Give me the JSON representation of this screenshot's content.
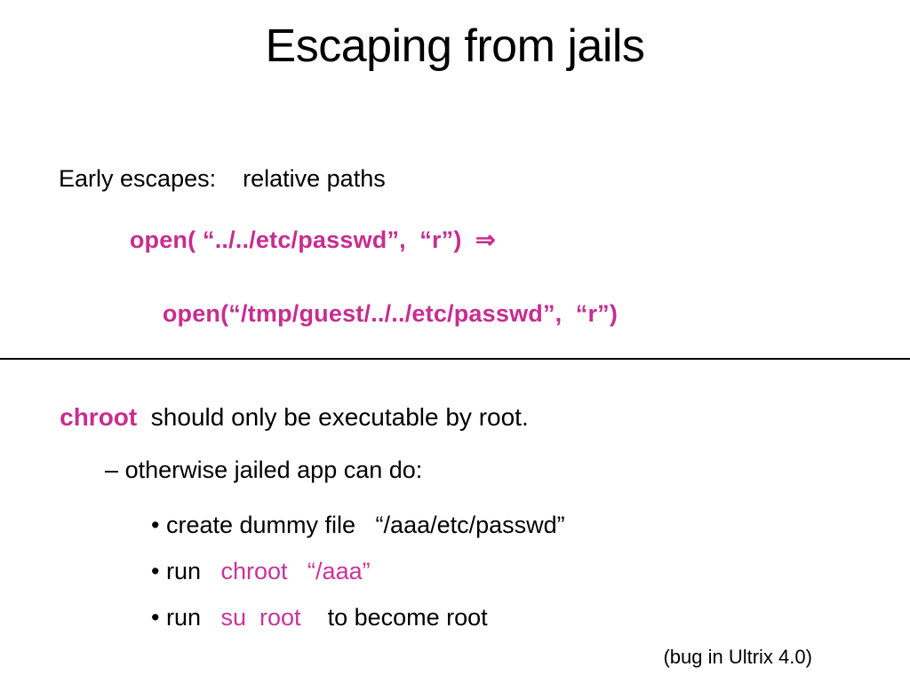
{
  "slide": {
    "title": "Escaping from jails",
    "colors": {
      "magenta_bold": "#C62E8F",
      "magenta_regular": "#CC3399",
      "text": "#000000",
      "background": "#FFFFFF"
    },
    "upper_section": {
      "intro_label": "Early escapes:",
      "intro_value": "relative paths",
      "code_line_1": "open( “../../etc/passwd”,  “r”)",
      "implies_symbol": "⇒",
      "code_line_2": "open(“/tmp/guest/../../etc/passwd”,  “r”)"
    },
    "lower_section": {
      "heading_code": "chroot",
      "heading_rest": "  should only be executable by root.",
      "dash_bullet_marker": "–",
      "dash_bullet_text": "otherwise jailed app can do:",
      "bullets": [
        {
          "marker": "•",
          "text_before": "create dummy file   “/aaa/etc/passwd”",
          "code": "",
          "text_after": ""
        },
        {
          "marker": "•",
          "text_before": "run   ",
          "code": "chroot   “/aaa”",
          "text_after": ""
        },
        {
          "marker": "•",
          "text_before": "run   ",
          "code": "su  root",
          "text_after": "    to become root"
        }
      ],
      "footnote": "(bug in Ultrix 4.0)"
    }
  }
}
